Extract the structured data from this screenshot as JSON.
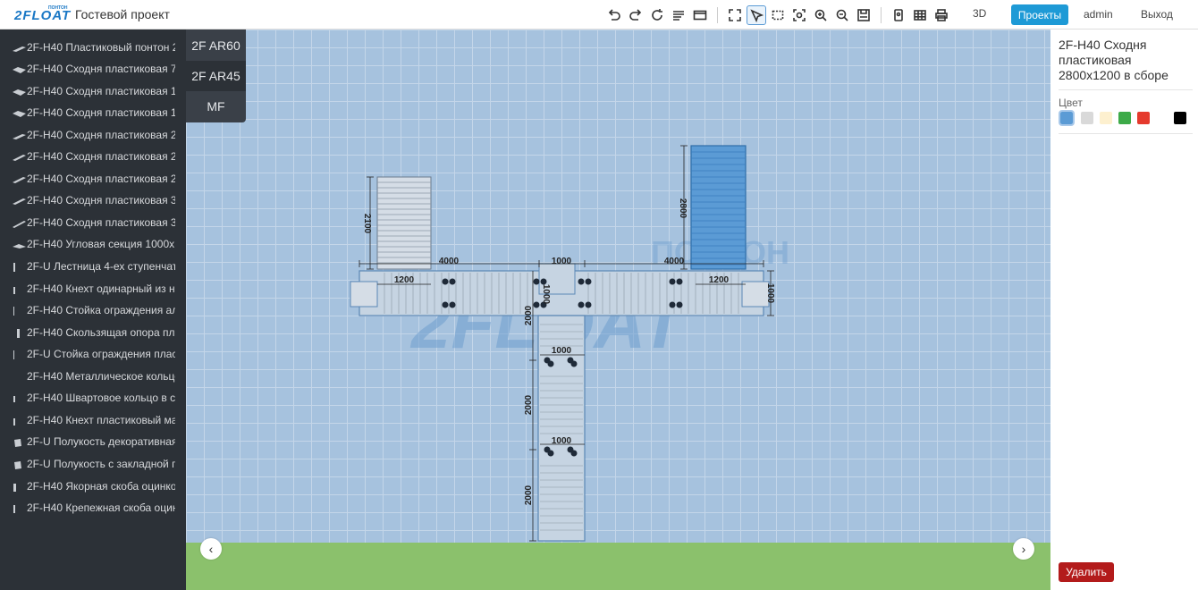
{
  "header": {
    "logo_text": "2FLOAT",
    "logo_small": "ПОНТОН",
    "project_title": "Гостевой проект",
    "tools": [
      "undo-icon",
      "redo-icon",
      "refresh-icon",
      "list-icon",
      "panels-icon",
      "fullscreen-icon",
      "select-icon",
      "rect-select-icon",
      "fit-icon",
      "zoom-in-icon",
      "zoom-out-icon",
      "save-icon",
      "export-icon",
      "table-icon",
      "print-icon"
    ],
    "btn_3d": "3D",
    "btn_projects": "Проекты",
    "btn_admin": "admin",
    "btn_exit": "Выход",
    "accent": "#1e9ad6"
  },
  "sidebar": {
    "items": [
      {
        "label": "2F-H40 Пластиковый понтон 2…"
      },
      {
        "label": "2F-H40 Сходня пластиковая 70…"
      },
      {
        "label": "2F-H40 Сходня пластиковая 12…"
      },
      {
        "label": "2F-H40 Сходня пластиковая 14…"
      },
      {
        "label": "2F-H40 Сходня пластиковая 21…"
      },
      {
        "label": "2F-H40 Сходня пластиковая 24…"
      },
      {
        "label": "2F-H40 Сходня пластиковая 28…"
      },
      {
        "label": "2F-H40 Сходня пластиковая 35…"
      },
      {
        "label": "2F-H40 Сходня пластиковая 36…"
      },
      {
        "label": "2F-H40 Угловая секция 1000x1…"
      },
      {
        "label": "2F-U Лестница 4-ех ступенчат…"
      },
      {
        "label": "2F-H40 Кнехт одинарный из н…"
      },
      {
        "label": "2F-H40 Стойка ограждения ал…"
      },
      {
        "label": "2F-H40 Скользящая опора пла…"
      },
      {
        "label": "2F-U Стойка ограждения пласт…"
      },
      {
        "label": "2F-H40 Металлическое кольцо…"
      },
      {
        "label": "2F-H40 Швартовое кольцо в с…"
      },
      {
        "label": "2F-H40 Кнехт пластиковый ма…"
      },
      {
        "label": "2F-U Полукость декоративная"
      },
      {
        "label": "2F-U Полукость с закладной га…"
      },
      {
        "label": "2F-H40 Якорная скоба оцинко…"
      },
      {
        "label": "2F-H40 Крепежная скоба оцин…"
      }
    ]
  },
  "categories": [
    "2F AR60",
    "2F AR45",
    "MF"
  ],
  "canvas": {
    "watermark_text": "2FLOAT",
    "watermark_small": "ПОНТОН",
    "dimensions": {
      "d2100": "2100",
      "d2800": "2800",
      "d4000_left": "4000",
      "d4000_right": "4000",
      "d1000_top": "1000",
      "d1200_left": "1200",
      "d1200_right": "1200",
      "d1000_right": "1000",
      "d1000_center_v": "1000",
      "d2000_a": "2000",
      "d1000_mid": "1000",
      "d2000_b": "2000",
      "d1000_low": "1000",
      "d2000_c": "2000"
    }
  },
  "props": {
    "title": "2F-H40 Сходня пластиковая 2800x1200 в сборе",
    "color_label": "Цвет",
    "colors": [
      "#5b9bd5",
      "#d9d9d9",
      "#fdf0cf",
      "#3daa48",
      "#e53a2d",
      "#000000"
    ],
    "delete_label": "Удалить"
  }
}
